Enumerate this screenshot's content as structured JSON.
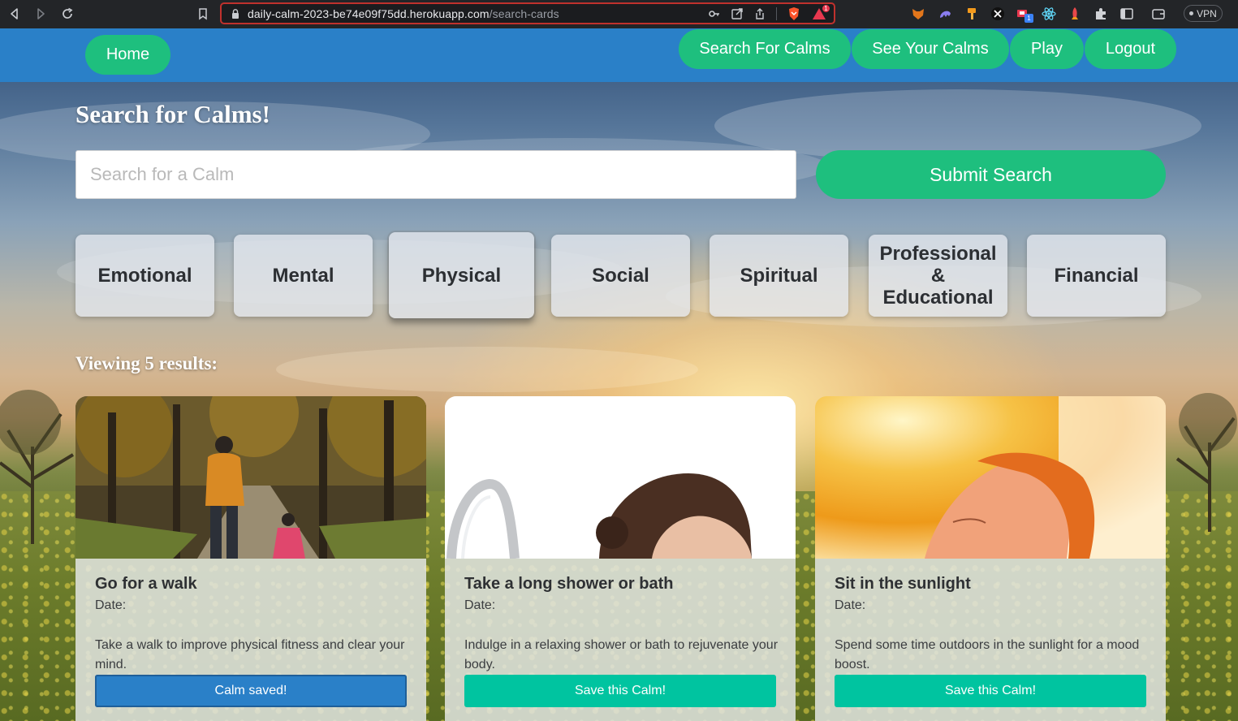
{
  "browser": {
    "url_host": "daily-calm-2023-be74e09f75dd.herokuapp.com",
    "url_path": "/search-cards",
    "vpn_label": "VPN",
    "notification_count": "1",
    "extension_badge": "1"
  },
  "nav": {
    "home": "Home",
    "search_for_calms": "Search For Calms",
    "see_your_calms": "See Your Calms",
    "play": "Play",
    "logout": "Logout"
  },
  "page_title": "Search for Calms!",
  "search": {
    "placeholder": "Search for a Calm",
    "value": "",
    "submit_label": "Submit Search"
  },
  "categories": [
    {
      "label": "Emotional",
      "active": false
    },
    {
      "label": "Mental",
      "active": false
    },
    {
      "label": "Physical",
      "active": true
    },
    {
      "label": "Social",
      "active": false
    },
    {
      "label": "Spiritual",
      "active": false
    },
    {
      "label": "Professional & Educational",
      "active": false
    },
    {
      "label": "Financial",
      "active": false
    }
  ],
  "results_label": "Viewing 5 results:",
  "cards": [
    {
      "title": "Go for a walk",
      "date_label": "Date:",
      "description": "Take a walk to improve physical fitness and clear your mind.",
      "button_label": "Calm saved!",
      "button_color": "#2a80c8"
    },
    {
      "title": "Take a long shower or bath",
      "date_label": "Date:",
      "description": "Indulge in a relaxing shower or bath to rejuvenate your body.",
      "button_label": "Save this Calm!",
      "button_color": "#00c4a0"
    },
    {
      "title": "Sit in the sunlight",
      "date_label": "Date:",
      "description": "Spend some time outdoors in the sunlight for a mood boost.",
      "button_label": "Save this Calm!",
      "button_color": "#00c4a0"
    }
  ],
  "colors": {
    "nav_bar": "#2a80c8",
    "accent_green": "#1ebf7e",
    "save_button": "#00c4a0",
    "saved_button": "#2a80c8"
  }
}
